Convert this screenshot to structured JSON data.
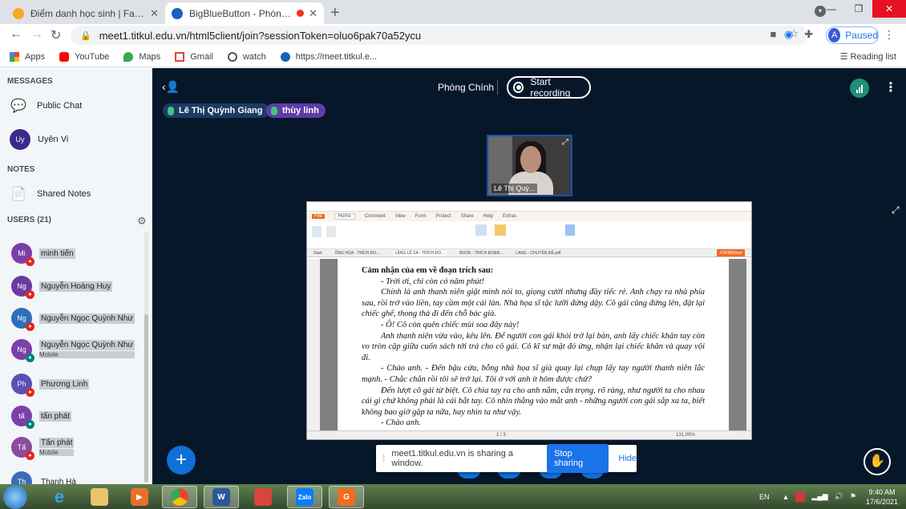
{
  "browser": {
    "tabs": [
      {
        "title": "Điểm danh học sinh | FaceID",
        "active": false
      },
      {
        "title": "BigBlueButton - Phòng Chính",
        "active": true
      }
    ],
    "url": "meet1.titkul.edu.vn/html5client/join?sessionToken=oluo6pak70a52ycu",
    "profile_initial": "A",
    "profile_label": "Paused",
    "bookmarks": [
      "Apps",
      "YouTube",
      "Maps",
      "Gmail",
      "watch",
      "https://meet.titkul.e..."
    ],
    "reading_list": "Reading list"
  },
  "sidebar": {
    "messages_title": "MESSAGES",
    "public_chat": "Public Chat",
    "chat_user_initials": "Uy",
    "chat_user_name": "Uyên Vi",
    "notes_title": "NOTES",
    "shared_notes": "Shared Notes",
    "users_title": "USERS (21)",
    "users": [
      {
        "initials": "Mi",
        "name": "minh tiến",
        "sub": ""
      },
      {
        "initials": "Ng",
        "name": "Nguyễn Hoàng Huy",
        "sub": ""
      },
      {
        "initials": "Ng",
        "name": "Nguyễn Ngọc Quỳnh Như",
        "sub": ""
      },
      {
        "initials": "Ng",
        "name": "Nguyễn Ngọc Quỳnh Như",
        "sub": "Mobile"
      },
      {
        "initials": "Ph",
        "name": "Phương Linh",
        "sub": ""
      },
      {
        "initials": "tấ",
        "name": "tấn phát",
        "sub": ""
      },
      {
        "initials": "Tấ",
        "name": "Tấn phát",
        "sub": "Mobile"
      },
      {
        "initials": "Th",
        "name": "Thanh Hà",
        "sub": ""
      }
    ]
  },
  "meeting": {
    "room_title": "Phòng Chính",
    "record_label": "Start recording",
    "talkers": [
      "Lê Thị Quỳnh Giang",
      "thùy linh"
    ],
    "webcam_caption": "Lê Thị Quỳ...",
    "colors": {
      "bg": "#06172a",
      "primary": "#0f70d7",
      "record_border": "#ffffff"
    }
  },
  "document": {
    "menu": [
      "File",
      "Home",
      "Comment",
      "View",
      "Form",
      "Protect",
      "Share",
      "Help",
      "Extras"
    ],
    "tabs": [
      "Start",
      "ÔNG HỌA - TRÍCH ĐO...",
      "LẶNG LẼ SA - TRÍCH ĐO...",
      "BOOK - TRÍCH ĐOẠN...",
      "LANG - CHUYÊN ĐỀ.pdf"
    ],
    "pdf_to_word": "PDF转Word",
    "heading": "Cảm nhận của em về đoạn trích sau:",
    "paragraphs": [
      "- Trời ơi, chỉ còn có năm phút!",
      "Chính là anh thanh niên giật mình nói to, giọng cười nhưng đầy tiếc rẻ. Anh chạy ra nhà phía sau, rồi trở vào liền, tay cầm một cái làn. Nhà họa sĩ tặc lưỡi đứng dậy. Cô gái cũng đứng lên, đặt lại chiếc ghế, thong thả đi đến chỗ bác già.",
      "- Ô! Cô còn quên chiếc mùi soa đây này!",
      "Anh thanh niên vừa vào, kêu lên. Để người con gái khỏi trở lại bàn, anh lấy chiếc khăn tay còn vo tròn cặp giữa cuốn sách tới trả cho cô gái. Cô kĩ sư mặt đỏ ửng, nhận lại chiếc khăn và quay vội đi.",
      "- Chào anh. - Đến bậu cửa, bỗng nhà họa sĩ già quay lại chụp lấy tay người thanh niên lắc mạnh. - Chắc chắn rồi tôi sẽ trở lại. Tôi ở với anh ít hôm được chứ?",
      "Đến lượt cô gái từ biệt. Cô chìa tay ra cho anh nắm, cẩn trọng, rõ ràng, như người ta cho nhau cái gì chứ không phải là cái bắt tay. Cô nhìn thẳng vào mắt anh - những người con gái sắp xa ta, biết không bao giờ gặp ta nữa, hay nhìn ta như vậy.",
      "- Chào anh."
    ],
    "page_indicator": "1 / 3",
    "zoom": "131.09%"
  },
  "share_notice": {
    "text": "meet1.titkul.edu.vn is sharing a window.",
    "stop": "Stop sharing",
    "hide": "Hide"
  },
  "taskbar": {
    "lang": "EN",
    "time": "9:40 AM",
    "date": "17/6/2021"
  }
}
